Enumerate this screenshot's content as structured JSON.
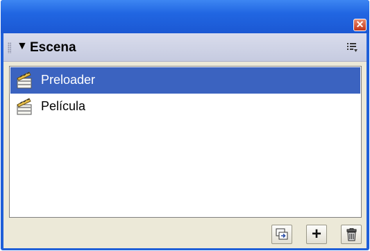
{
  "panel": {
    "title": "Escena",
    "collapse_glyph": "▼",
    "close_glyph": "✕"
  },
  "scenes": [
    {
      "label": "Preloader",
      "selected": true,
      "icon": "clapperboard-icon"
    },
    {
      "label": "Película",
      "selected": false,
      "icon": "clapperboard-icon"
    }
  ],
  "toolbar": {
    "buttons": [
      "duplicate-scene-icon",
      "add-scene-icon",
      "delete-scene-icon"
    ],
    "add_glyph": "+"
  },
  "colors": {
    "title_bar": "#2166e2",
    "selection": "#3b63c0",
    "panel_bg": "#ece9d8",
    "header_bg": "#c6cbe0",
    "close_button": "#c2351a"
  }
}
